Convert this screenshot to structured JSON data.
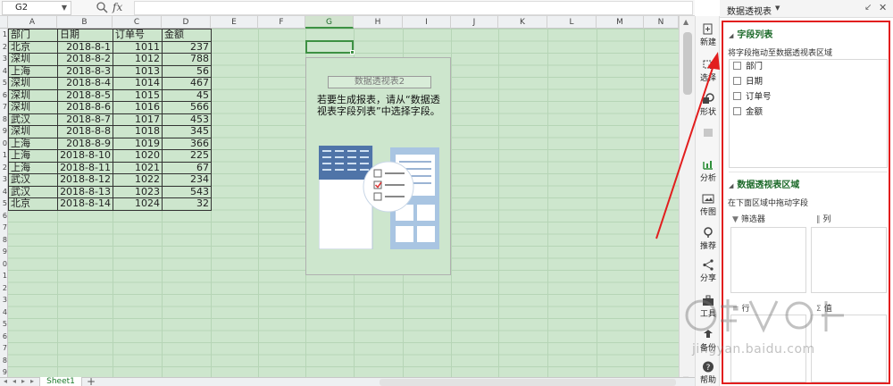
{
  "formula_bar": {
    "name_box": "G2",
    "fx": "fx"
  },
  "columns": [
    "A",
    "B",
    "C",
    "D",
    "E",
    "F",
    "G",
    "H",
    "I",
    "J",
    "K",
    "L",
    "M",
    "N"
  ],
  "selected_column": "G",
  "row_numbers": [
    "",
    "1",
    "2",
    "3",
    "4",
    "5",
    "6",
    "7",
    "8",
    "9",
    "0",
    "1",
    "2",
    "3",
    "4",
    "5",
    "6",
    "7",
    "8",
    "9",
    "0",
    "1",
    "2",
    "3",
    "4",
    "5",
    "6",
    "7",
    "8",
    "9"
  ],
  "table": {
    "headers": [
      "部门",
      "日期",
      "订单号",
      "金额"
    ],
    "rows": [
      [
        "北京",
        "2018-8-1",
        "1011",
        "237"
      ],
      [
        "深圳",
        "2018-8-2",
        "1012",
        "788"
      ],
      [
        "上海",
        "2018-8-3",
        "1013",
        "56"
      ],
      [
        "深圳",
        "2018-8-4",
        "1014",
        "467"
      ],
      [
        "深圳",
        "2018-8-5",
        "1015",
        "45"
      ],
      [
        "深圳",
        "2018-8-6",
        "1016",
        "566"
      ],
      [
        "武汉",
        "2018-8-7",
        "1017",
        "453"
      ],
      [
        "深圳",
        "2018-8-8",
        "1018",
        "345"
      ],
      [
        "上海",
        "2018-8-9",
        "1019",
        "366"
      ],
      [
        "上海",
        "2018-8-10",
        "1020",
        "225"
      ],
      [
        "上海",
        "2018-8-11",
        "1021",
        "67"
      ],
      [
        "武汉",
        "2018-8-12",
        "1022",
        "234"
      ],
      [
        "武汉",
        "2018-8-13",
        "1023",
        "543"
      ],
      [
        "北京",
        "2018-8-14",
        "1024",
        "32"
      ]
    ]
  },
  "pivot_placeholder": {
    "name": "数据透视表2",
    "description": "若要生成报表，请从“数据透视表字段列表”中选择字段。"
  },
  "sheet_tabs": {
    "active": "Sheet1",
    "add": "+"
  },
  "tool_rail": [
    {
      "label": "新建",
      "icon": "new-icon"
    },
    {
      "label": "选择",
      "icon": "select-icon"
    },
    {
      "label": "形状",
      "icon": "shape-icon"
    },
    {
      "label": "",
      "icon": "disabled-icon"
    },
    {
      "label": "分析",
      "icon": "analysis-icon"
    },
    {
      "label": "传图",
      "icon": "upload-image-icon"
    },
    {
      "label": "推荐",
      "icon": "recommend-icon"
    },
    {
      "label": "分享",
      "icon": "share-icon"
    },
    {
      "label": "工具",
      "icon": "toolbox-icon"
    },
    {
      "label": "备份",
      "icon": "backup-icon"
    },
    {
      "label": "帮助",
      "icon": "help-icon"
    }
  ],
  "panel": {
    "title": "数据透视表",
    "field_list_title": "字段列表",
    "field_list_hint": "将字段拖动至数据透视表区域",
    "fields": [
      "部门",
      "日期",
      "订单号",
      "金额"
    ],
    "areas_title": "数据透视表区域",
    "areas_hint": "在下面区域中拖动字段",
    "filter_label": "筛选器",
    "columns_label": "列",
    "rows_label": "行",
    "values_label": "值"
  },
  "watermark": "jingyan.baidu.com",
  "colors": {
    "grid_bg": "#cde6cd",
    "accent_green": "#3d9143",
    "highlight_red": "#e21e1e"
  }
}
